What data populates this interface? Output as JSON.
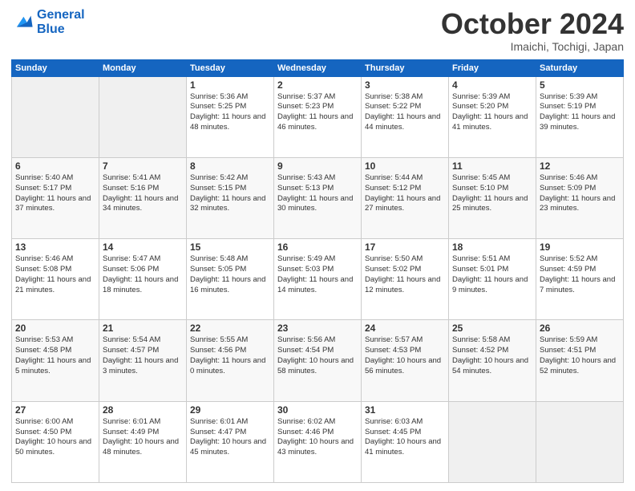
{
  "header": {
    "logo_line1": "General",
    "logo_line2": "Blue",
    "month": "October 2024",
    "location": "Imaichi, Tochigi, Japan"
  },
  "weekdays": [
    "Sunday",
    "Monday",
    "Tuesday",
    "Wednesday",
    "Thursday",
    "Friday",
    "Saturday"
  ],
  "weeks": [
    [
      {
        "day": "",
        "info": ""
      },
      {
        "day": "",
        "info": ""
      },
      {
        "day": "1",
        "info": "Sunrise: 5:36 AM\nSunset: 5:25 PM\nDaylight: 11 hours and 48 minutes."
      },
      {
        "day": "2",
        "info": "Sunrise: 5:37 AM\nSunset: 5:23 PM\nDaylight: 11 hours and 46 minutes."
      },
      {
        "day": "3",
        "info": "Sunrise: 5:38 AM\nSunset: 5:22 PM\nDaylight: 11 hours and 44 minutes."
      },
      {
        "day": "4",
        "info": "Sunrise: 5:39 AM\nSunset: 5:20 PM\nDaylight: 11 hours and 41 minutes."
      },
      {
        "day": "5",
        "info": "Sunrise: 5:39 AM\nSunset: 5:19 PM\nDaylight: 11 hours and 39 minutes."
      }
    ],
    [
      {
        "day": "6",
        "info": "Sunrise: 5:40 AM\nSunset: 5:17 PM\nDaylight: 11 hours and 37 minutes."
      },
      {
        "day": "7",
        "info": "Sunrise: 5:41 AM\nSunset: 5:16 PM\nDaylight: 11 hours and 34 minutes."
      },
      {
        "day": "8",
        "info": "Sunrise: 5:42 AM\nSunset: 5:15 PM\nDaylight: 11 hours and 32 minutes."
      },
      {
        "day": "9",
        "info": "Sunrise: 5:43 AM\nSunset: 5:13 PM\nDaylight: 11 hours and 30 minutes."
      },
      {
        "day": "10",
        "info": "Sunrise: 5:44 AM\nSunset: 5:12 PM\nDaylight: 11 hours and 27 minutes."
      },
      {
        "day": "11",
        "info": "Sunrise: 5:45 AM\nSunset: 5:10 PM\nDaylight: 11 hours and 25 minutes."
      },
      {
        "day": "12",
        "info": "Sunrise: 5:46 AM\nSunset: 5:09 PM\nDaylight: 11 hours and 23 minutes."
      }
    ],
    [
      {
        "day": "13",
        "info": "Sunrise: 5:46 AM\nSunset: 5:08 PM\nDaylight: 11 hours and 21 minutes."
      },
      {
        "day": "14",
        "info": "Sunrise: 5:47 AM\nSunset: 5:06 PM\nDaylight: 11 hours and 18 minutes."
      },
      {
        "day": "15",
        "info": "Sunrise: 5:48 AM\nSunset: 5:05 PM\nDaylight: 11 hours and 16 minutes."
      },
      {
        "day": "16",
        "info": "Sunrise: 5:49 AM\nSunset: 5:03 PM\nDaylight: 11 hours and 14 minutes."
      },
      {
        "day": "17",
        "info": "Sunrise: 5:50 AM\nSunset: 5:02 PM\nDaylight: 11 hours and 12 minutes."
      },
      {
        "day": "18",
        "info": "Sunrise: 5:51 AM\nSunset: 5:01 PM\nDaylight: 11 hours and 9 minutes."
      },
      {
        "day": "19",
        "info": "Sunrise: 5:52 AM\nSunset: 4:59 PM\nDaylight: 11 hours and 7 minutes."
      }
    ],
    [
      {
        "day": "20",
        "info": "Sunrise: 5:53 AM\nSunset: 4:58 PM\nDaylight: 11 hours and 5 minutes."
      },
      {
        "day": "21",
        "info": "Sunrise: 5:54 AM\nSunset: 4:57 PM\nDaylight: 11 hours and 3 minutes."
      },
      {
        "day": "22",
        "info": "Sunrise: 5:55 AM\nSunset: 4:56 PM\nDaylight: 11 hours and 0 minutes."
      },
      {
        "day": "23",
        "info": "Sunrise: 5:56 AM\nSunset: 4:54 PM\nDaylight: 10 hours and 58 minutes."
      },
      {
        "day": "24",
        "info": "Sunrise: 5:57 AM\nSunset: 4:53 PM\nDaylight: 10 hours and 56 minutes."
      },
      {
        "day": "25",
        "info": "Sunrise: 5:58 AM\nSunset: 4:52 PM\nDaylight: 10 hours and 54 minutes."
      },
      {
        "day": "26",
        "info": "Sunrise: 5:59 AM\nSunset: 4:51 PM\nDaylight: 10 hours and 52 minutes."
      }
    ],
    [
      {
        "day": "27",
        "info": "Sunrise: 6:00 AM\nSunset: 4:50 PM\nDaylight: 10 hours and 50 minutes."
      },
      {
        "day": "28",
        "info": "Sunrise: 6:01 AM\nSunset: 4:49 PM\nDaylight: 10 hours and 48 minutes."
      },
      {
        "day": "29",
        "info": "Sunrise: 6:01 AM\nSunset: 4:47 PM\nDaylight: 10 hours and 45 minutes."
      },
      {
        "day": "30",
        "info": "Sunrise: 6:02 AM\nSunset: 4:46 PM\nDaylight: 10 hours and 43 minutes."
      },
      {
        "day": "31",
        "info": "Sunrise: 6:03 AM\nSunset: 4:45 PM\nDaylight: 10 hours and 41 minutes."
      },
      {
        "day": "",
        "info": ""
      },
      {
        "day": "",
        "info": ""
      }
    ]
  ]
}
